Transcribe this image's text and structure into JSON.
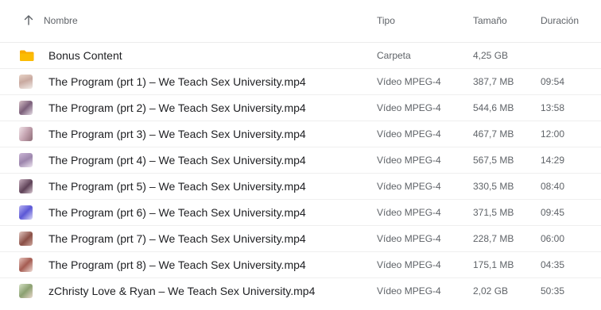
{
  "header": {
    "sort_icon": "arrow-up-icon",
    "name": "Nombre",
    "type": "Tipo",
    "size": "Tamaño",
    "duration": "Duración"
  },
  "colors": {
    "folder": "#f9ab00",
    "row_border": "#efefef",
    "secondary_text": "#5f6368"
  },
  "files": [
    {
      "icon": "folder-icon",
      "name": "Bonus Content",
      "type": "Carpeta",
      "size": "4,25 GB",
      "duration": ""
    },
    {
      "icon": "video-thumbnail",
      "name": "The Program (prt 1) – We Teach Sex University.mp4",
      "type": "Vídeo MPEG-4",
      "size": "387,7 MB",
      "duration": "09:54"
    },
    {
      "icon": "video-thumbnail",
      "name": "The Program (prt 2) – We Teach Sex University.mp4",
      "type": "Vídeo MPEG-4",
      "size": "544,6 MB",
      "duration": "13:58"
    },
    {
      "icon": "video-thumbnail",
      "name": "The Program (prt 3) – We Teach Sex University.mp4",
      "type": "Vídeo MPEG-4",
      "size": "467,7 MB",
      "duration": "12:00"
    },
    {
      "icon": "video-thumbnail",
      "name": "The Program (prt 4) – We Teach Sex University.mp4",
      "type": "Vídeo MPEG-4",
      "size": "567,5 MB",
      "duration": "14:29"
    },
    {
      "icon": "video-thumbnail",
      "name": "The Program (prt 5) – We Teach Sex University.mp4",
      "type": "Vídeo MPEG-4",
      "size": "330,5 MB",
      "duration": "08:40"
    },
    {
      "icon": "video-thumbnail",
      "name": "The Program (prt 6) – We Teach Sex University.mp4",
      "type": "Vídeo MPEG-4",
      "size": "371,5 MB",
      "duration": "09:45"
    },
    {
      "icon": "video-thumbnail",
      "name": "The Program (prt 7) – We Teach Sex University.mp4",
      "type": "Vídeo MPEG-4",
      "size": "228,7 MB",
      "duration": "06:00"
    },
    {
      "icon": "video-thumbnail",
      "name": "The Program (prt 8) – We Teach Sex University.mp4",
      "type": "Vídeo MPEG-4",
      "size": "175,1 MB",
      "duration": "04:35"
    },
    {
      "icon": "video-thumbnail",
      "name": "zChristy Love & Ryan – We Teach Sex University.mp4",
      "type": "Vídeo MPEG-4",
      "size": "2,02 GB",
      "duration": "50:35"
    }
  ]
}
